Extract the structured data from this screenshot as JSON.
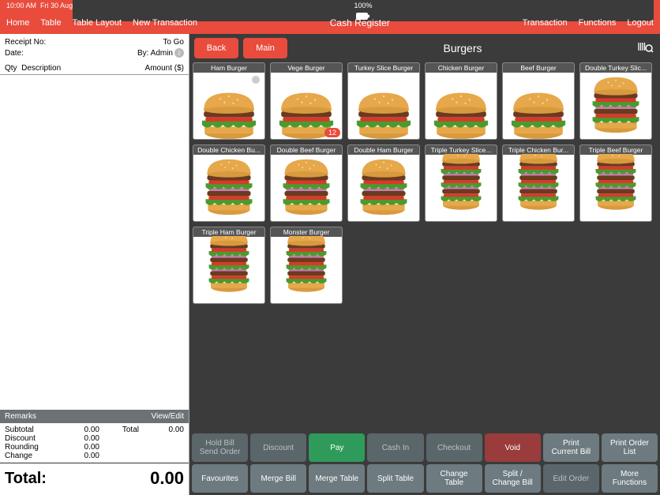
{
  "status": {
    "time": "10:00 AM",
    "date": "Fri 30 Aug",
    "battery": "100%"
  },
  "header": {
    "nav": {
      "home": "Home",
      "table": "Table",
      "layout": "Table Layout",
      "newtx": "New Transaction"
    },
    "title": "Cash Register",
    "rnav": {
      "tx": "Transaction",
      "fn": "Functions",
      "logout": "Logout"
    }
  },
  "receipt": {
    "no_label": "Receipt No:",
    "no_value": "To Go",
    "date_label": "Date:",
    "by_label": "By: Admin",
    "qty_label": "Qty",
    "desc_label": "Description",
    "amount_label": "Amount ($)"
  },
  "remarks": {
    "label": "Remarks",
    "action": "View/Edit"
  },
  "totals": {
    "subtotal_label": "Subtotal",
    "subtotal": "0.00",
    "discount_label": "Discount",
    "discount": "0.00",
    "rounding_label": "Rounding",
    "rounding": "0.00",
    "change_label": "Change",
    "change": "0.00",
    "total_label": "Total",
    "total": "0.00",
    "grand_label": "Total:",
    "grand_value": "0.00"
  },
  "category": {
    "back": "Back",
    "main": "Main",
    "title": "Burgers"
  },
  "products": [
    {
      "name": "Ham Burger",
      "layers": 1,
      "dot": true
    },
    {
      "name": "Vege Burger",
      "layers": 1,
      "badge": "12"
    },
    {
      "name": "Turkey Slice Burger",
      "layers": 1
    },
    {
      "name": "Chicken Burger",
      "layers": 1
    },
    {
      "name": "Beef Burger",
      "layers": 1
    },
    {
      "name": "Double Turkey Slic...",
      "layers": 2
    },
    {
      "name": "Double Chicken Bu...",
      "layers": 2
    },
    {
      "name": "Double Beef Burger",
      "layers": 2
    },
    {
      "name": "Double Ham Burger",
      "layers": 2
    },
    {
      "name": "Triple Turkey Slice...",
      "layers": 3
    },
    {
      "name": "Triple Chicken Bur...",
      "layers": 3
    },
    {
      "name": "Triple Beef Burger",
      "layers": 3
    },
    {
      "name": "Triple Ham Burger",
      "layers": 3
    },
    {
      "name": "Monster Burger",
      "layers": 3
    }
  ],
  "fns": {
    "row1": {
      "hold": "Hold Bill\nSend Order",
      "discount": "Discount",
      "pay": "Pay",
      "cashin": "Cash In",
      "checkout": "Checkout",
      "void": "Void",
      "printcb": "Print\nCurrent Bill",
      "printol": "Print Order\nList"
    },
    "row2": {
      "fav": "Favourites",
      "merge": "Merge Bill",
      "mergetbl": "Merge Table",
      "split": "Split Table",
      "changetbl": "Change\nTable",
      "splitchg": "Split /\nChange Bill",
      "edit": "Edit Order",
      "more": "More\nFunctions"
    }
  }
}
